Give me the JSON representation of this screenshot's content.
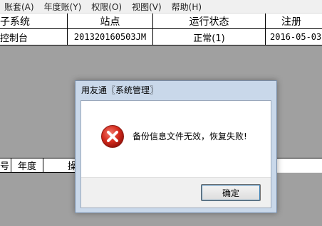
{
  "menu": [
    "账套(A)",
    "年度账(Y)",
    "权限(O)",
    "视图(V)",
    "帮助(H)"
  ],
  "top_table": {
    "headers": [
      "子系统",
      "站点",
      "运行状态",
      "注册"
    ],
    "row": [
      "控制台",
      "201320160503JM",
      "正常(1)",
      "2016-05-03"
    ]
  },
  "bottom_table": {
    "headers": [
      "号",
      "年度",
      "操"
    ]
  },
  "dialog": {
    "title": "用友通〖系统管理〗",
    "message": "备份信息文件无效，恢复失败!",
    "ok_label": "确定",
    "icon": "error-icon"
  }
}
